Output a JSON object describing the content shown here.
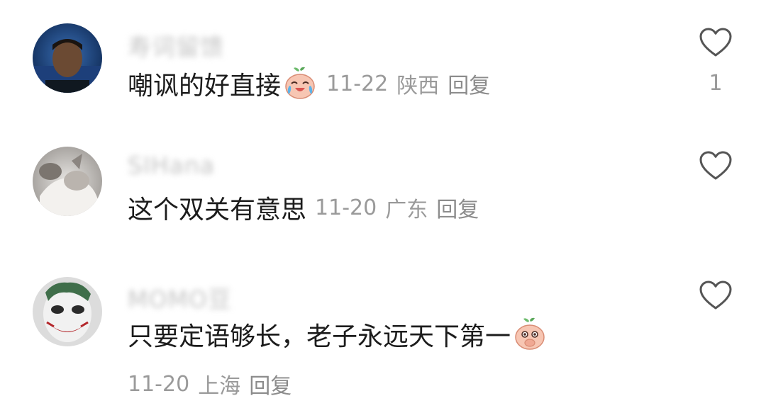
{
  "comments": [
    {
      "username": "寿词留馈",
      "text": "嘲讽的好直接",
      "emoji": "laughing-tears-peach-emoji",
      "date": "11-22",
      "location": "陕西",
      "reply_label": "回复",
      "like_count": "1"
    },
    {
      "username": "SIHana",
      "text": "这个双关有意思",
      "date": "11-20",
      "location": "广东",
      "reply_label": "回复",
      "like_count": ""
    },
    {
      "username": "MOMO豆",
      "text": "只要定语够长，老子永远天下第一",
      "emoji": "cover-mouth-peach-emoji",
      "date": "11-20",
      "location": "上海",
      "reply_label": "回复",
      "like_count": ""
    }
  ],
  "icons": {
    "like": "heart-outline-icon"
  },
  "colors": {
    "text": "#1c1c1c",
    "meta": "#9a9a9a",
    "username": "#c4c4c4",
    "heart_stroke": "#555555"
  }
}
